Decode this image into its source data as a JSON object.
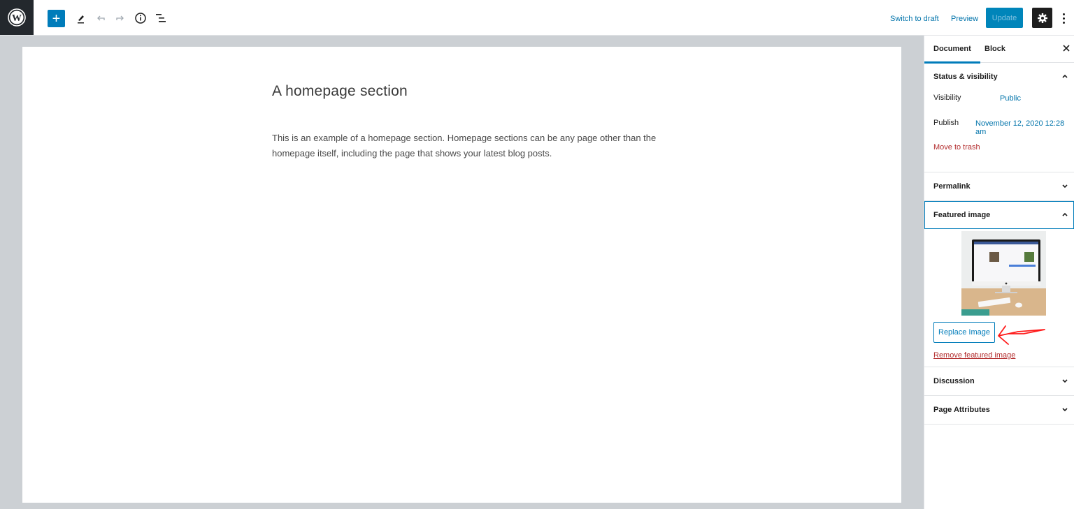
{
  "topbar": {
    "logo_icon": "wordpress-logo-icon",
    "add_block_label": "+",
    "tools": [
      {
        "name": "edit-tool-icon"
      },
      {
        "name": "undo-icon"
      },
      {
        "name": "redo-icon"
      },
      {
        "name": "info-icon"
      },
      {
        "name": "block-navigation-icon"
      }
    ],
    "switch_to_draft": "Switch to draft",
    "preview": "Preview",
    "update": "Update",
    "settings_icon": "gear-icon",
    "more_icon": "more-vertical-icon"
  },
  "colors": {
    "accent": "#007cba",
    "link": "#0073aa",
    "danger": "#b32d2e",
    "canvas_bg": "#ccd0d4",
    "dark": "#23282d",
    "annotation": "#ff0000"
  },
  "editor": {
    "title": "A homepage section",
    "body": "This is an example of a homepage section. Homepage sections can be any page other than the homepage itself, including the page that shows your latest blog posts."
  },
  "sidebar": {
    "tabs": [
      {
        "label": "Document",
        "active": true
      },
      {
        "label": "Block",
        "active": false
      }
    ],
    "close_icon": "close-icon",
    "status_visibility": {
      "title": "Status & visibility",
      "expanded": true,
      "visibility_label": "Visibility",
      "visibility_value": "Public",
      "publish_label": "Publish",
      "publish_value": "November 12, 2020 12:28 am",
      "trash_label": "Move to trash"
    },
    "permalink": {
      "title": "Permalink",
      "expanded": false
    },
    "featured_image": {
      "title": "Featured image",
      "expanded": true,
      "image_alt": "iMac on a wooden desk showing a website",
      "replace_label": "Replace Image",
      "remove_label": "Remove featured image"
    },
    "discussion": {
      "title": "Discussion",
      "expanded": false
    },
    "page_attributes": {
      "title": "Page Attributes",
      "expanded": false
    }
  },
  "annotation": {
    "type": "red-arrow",
    "points_to": "Replace Image"
  }
}
